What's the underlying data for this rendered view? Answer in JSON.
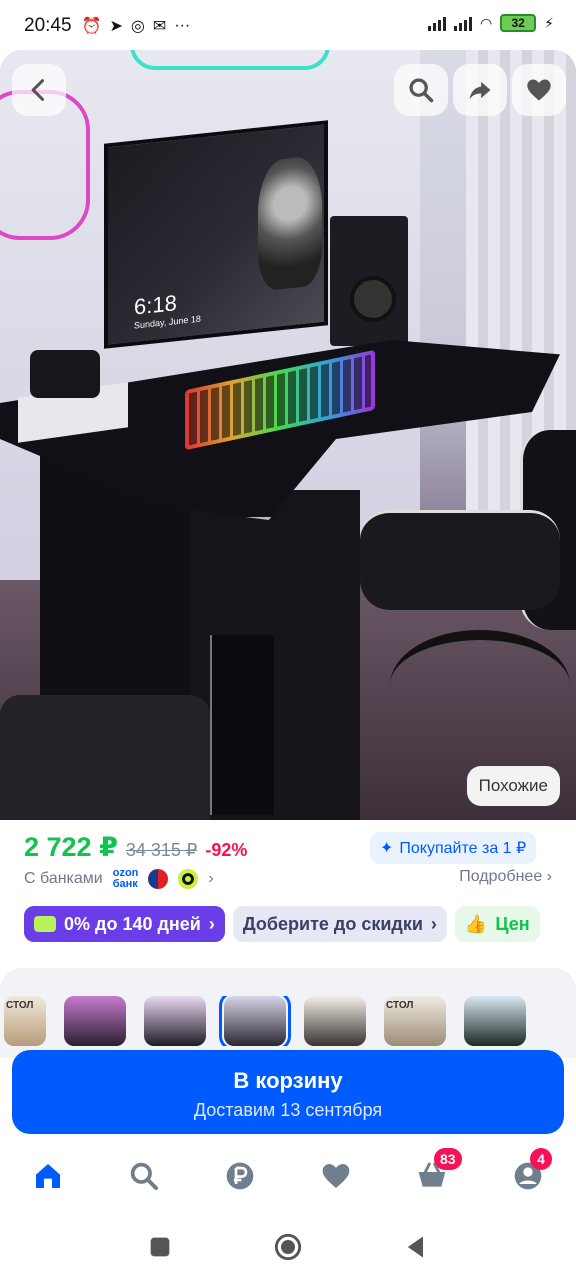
{
  "status_bar": {
    "time": "20:45",
    "battery": "32",
    "icons_left": [
      "alarm-icon",
      "telegram-icon",
      "chat-icon",
      "mail-icon",
      "more-icon"
    ],
    "more": "···"
  },
  "hero": {
    "similar_label": "Похожие",
    "monitor_time": "6:18",
    "monitor_date": "Sunday, June 18"
  },
  "price": {
    "current": "2 722 ₽",
    "old": "34 315 ₽",
    "discount": "-92%",
    "promo_label": "Покупайте за 1 ₽",
    "banks_label": "С банками",
    "ozon_line1": "ozon",
    "ozon_line2": "банк",
    "details_link": "Подробнее",
    "chevron": "›"
  },
  "chips": [
    {
      "label": "0% до 140 дней"
    },
    {
      "label": "Доберите до скидки"
    },
    {
      "label": "Цен"
    }
  ],
  "thumbnails": {
    "first_label": "СТОЛ",
    "sixth_label": "СТОЛ",
    "active_index": 3
  },
  "cart": {
    "title": "В корзину",
    "subtitle": "Доставим 13 сентября"
  },
  "bottom_nav": {
    "cart_badge": "83",
    "profile_badge": "4"
  },
  "colors": {
    "accent": "#005bff",
    "price_green": "#10c44c",
    "discount_red": "#f91155",
    "chip_purple": "#6a3de8"
  }
}
